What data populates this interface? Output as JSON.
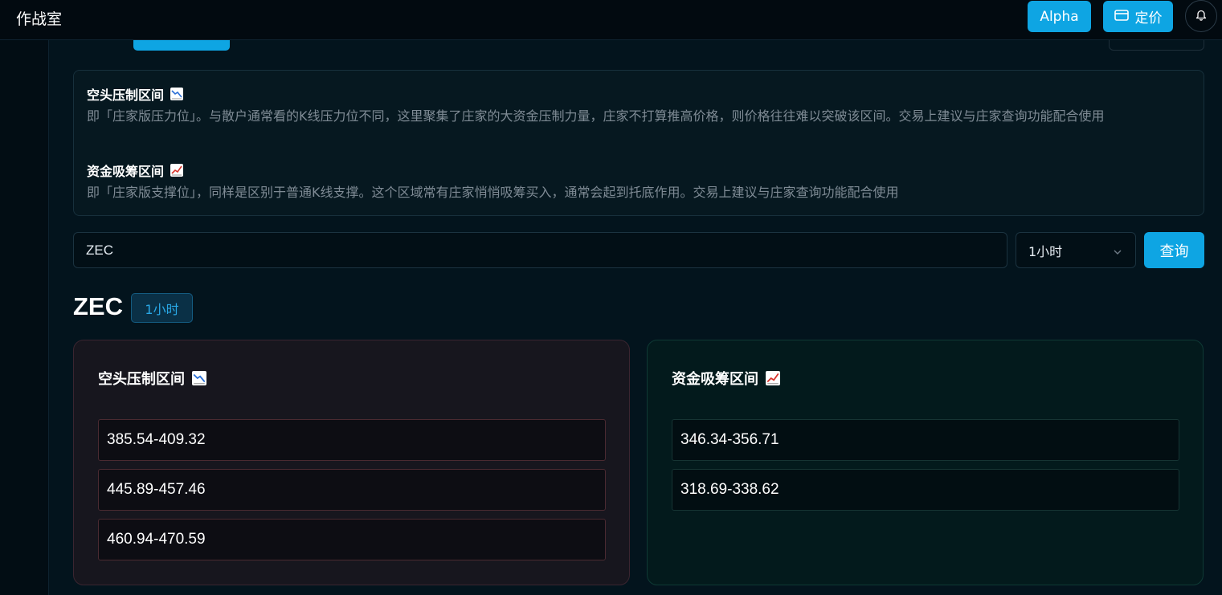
{
  "header": {
    "app_title": "作战室",
    "alpha_label": "Alpha",
    "pricing_label": "定价"
  },
  "info": {
    "short_zone_title": "空头压制区间",
    "short_zone_desc": "即「庄家版压力位」。与散户通常看的K线压力位不同，这里聚集了庄家的大资金压制力量，庄家不打算推高价格，则价格往往难以突破该区间。交易上建议与庄家查询功能配合使用",
    "long_zone_title": "资金吸筹区间",
    "long_zone_desc": "即「庄家版支撑位」，同样是区别于普通K线支撑。这个区域常有庄家悄悄吸筹买入，通常会起到托底作用。交易上建议与庄家查询功能配合使用"
  },
  "search": {
    "symbol_value": "ZEC",
    "timeframe_selected": "1小时",
    "query_label": "查询"
  },
  "result": {
    "symbol": "ZEC",
    "timeframe_badge": "1小时",
    "short_zones": {
      "title": "空头压制区间",
      "ranges": [
        "385.54-409.32",
        "445.89-457.46",
        "460.94-470.59"
      ]
    },
    "long_zones": {
      "title": "资金吸筹区间",
      "ranges": [
        "346.34-356.71",
        "318.69-338.62"
      ]
    }
  },
  "colors": {
    "accent": "#0ea5e3",
    "short_border": "#4a2a31",
    "long_border": "#163433"
  },
  "icons": [
    "bank-card-icon",
    "bell-icon",
    "chart-down-icon",
    "chart-up-icon",
    "chevron-down-icon"
  ]
}
